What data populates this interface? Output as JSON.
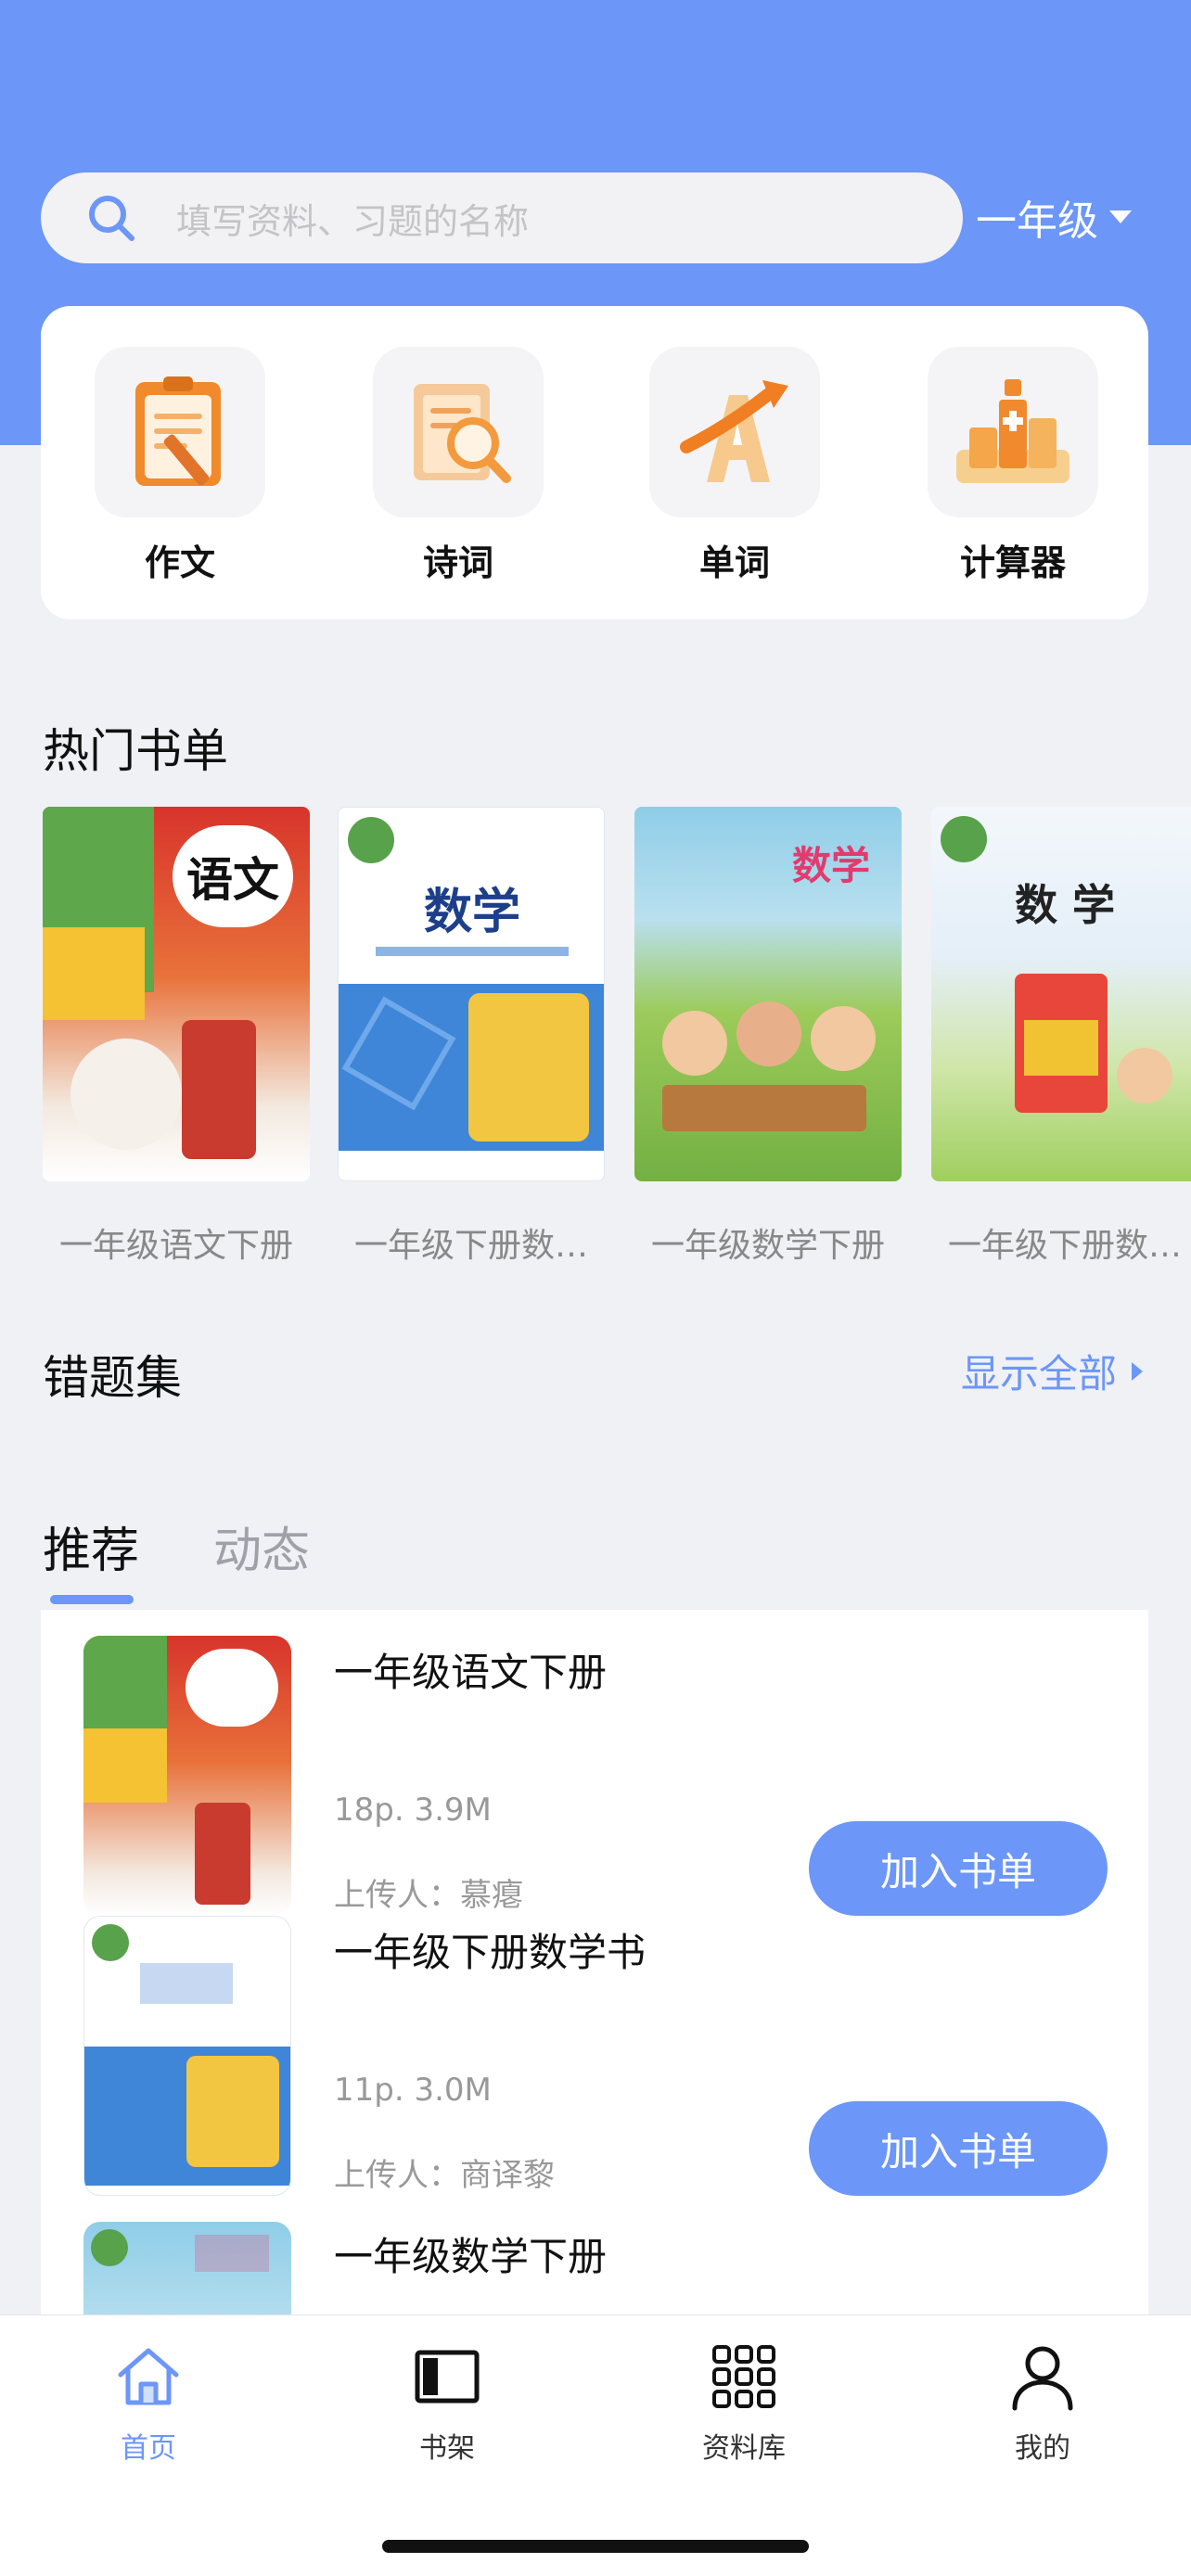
{
  "search": {
    "placeholder": "填写资料、习题的名称"
  },
  "grade": {
    "value": "一年级"
  },
  "tools": [
    {
      "label": "作文",
      "icon": "essay-icon"
    },
    {
      "label": "诗词",
      "icon": "poetry-icon"
    },
    {
      "label": "单词",
      "icon": "words-icon"
    },
    {
      "label": "计算器",
      "icon": "calculator-icon"
    }
  ],
  "hot": {
    "title": "热门书单",
    "books": [
      {
        "caption": "一年级语文下册",
        "cover_text": "语文"
      },
      {
        "caption": "一年级下册数…",
        "cover_text": "数学"
      },
      {
        "caption": "一年级数学下册",
        "cover_text": "数学"
      },
      {
        "caption": "一年级下册数…",
        "cover_text": "数 学"
      }
    ]
  },
  "mistakes": {
    "title": "错题集",
    "show_all": "显示全部"
  },
  "tabs": {
    "recommend": "推荐",
    "activity": "动态"
  },
  "recommend": [
    {
      "title": "一年级语文下册",
      "meta": "18p. 3.9M",
      "uploader": "上传人：慕瘪",
      "button": "加入书单"
    },
    {
      "title": "一年级下册数学书",
      "meta": "11p. 3.0M",
      "uploader": "上传人：商译黎",
      "button": "加入书单"
    },
    {
      "title": "一年级数学下册"
    }
  ],
  "tabbar": [
    {
      "label": "首页",
      "icon": "home-icon",
      "active": true
    },
    {
      "label": "书架",
      "icon": "bookshelf-icon",
      "active": false
    },
    {
      "label": "资料库",
      "icon": "library-grid-icon",
      "active": false
    },
    {
      "label": "我的",
      "icon": "profile-icon",
      "active": false
    }
  ],
  "colors": {
    "primary": "#6c96f7",
    "background": "#f0f1f5"
  }
}
